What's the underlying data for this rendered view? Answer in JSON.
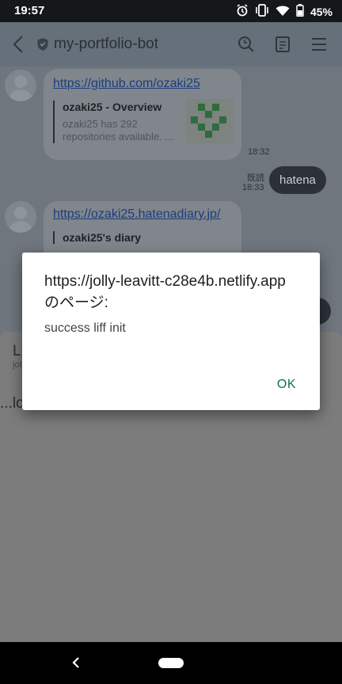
{
  "statusbar": {
    "time": "19:57",
    "battery": "45%"
  },
  "header": {
    "title": "my-portfolio-bot"
  },
  "messages": [
    {
      "link": "https://github.com/ozaki25",
      "card_title": "ozaki25 - Overview",
      "card_desc": "ozaki25 has 292 repositories available. ...",
      "time": "18:32"
    },
    {
      "read": "既読",
      "time": "18:33",
      "text": "hatena"
    },
    {
      "link": "https://ozaki25.hatenadiary.jp/",
      "card_title": "ozaki25's diary"
    }
  ],
  "sheet": {
    "title": "L",
    "subtitle": "jolly",
    "loading": "...lo"
  },
  "dialog": {
    "title": "https://jolly-leavitt-c28e4b.netlify.app のページ:",
    "message": "success liff init",
    "ok_label": "OK"
  }
}
